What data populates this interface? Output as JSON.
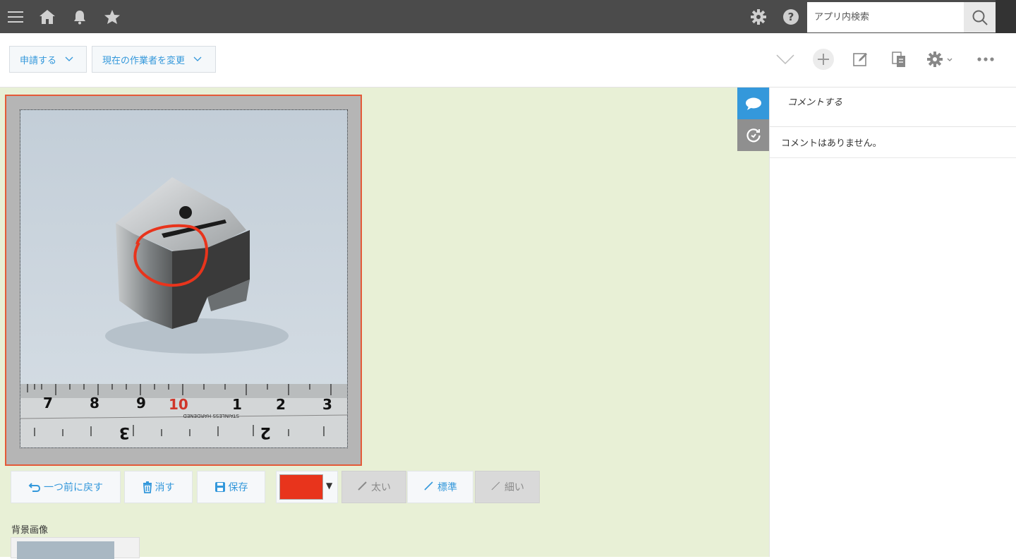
{
  "topbar": {
    "icons": [
      "menu-icon",
      "home-icon",
      "bell-icon",
      "star-icon"
    ],
    "right_icons": [
      "gear-icon",
      "help-icon"
    ],
    "search_placeholder": "アプリ内検索"
  },
  "actions": {
    "apply_label": "申請する",
    "change_assignee_label": "現在の作業者を変更",
    "tools": [
      "chevron-down-icon",
      "add-icon",
      "edit-icon",
      "copy-icon",
      "settings-icon",
      "more-icon"
    ]
  },
  "drawing": {
    "undo_label": "一つ前に戻す",
    "delete_label": "消す",
    "save_label": "保存",
    "color": "#e8341c",
    "thick_label": "太い",
    "normal_label": "標準",
    "thin_label": "細い",
    "background_label": "背景画像"
  },
  "ruler": {
    "numbers": [
      "7",
      "8",
      "9",
      "10",
      "1",
      "2",
      "3"
    ],
    "lower_numbers": [
      "3",
      "2"
    ],
    "stamp": "STAINLESS HARDENED"
  },
  "sidebar": {
    "comment_placeholder": "コメントする",
    "no_comments": "コメントはありません。"
  },
  "colors": {
    "accent": "#3498db",
    "topbar": "#4b4b4b",
    "main_bg": "#e8f0d6",
    "frame": "#e45a38"
  }
}
